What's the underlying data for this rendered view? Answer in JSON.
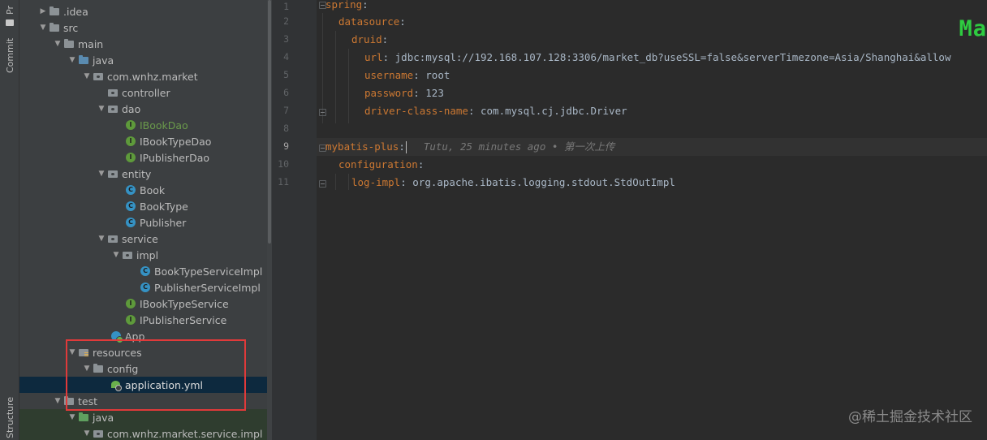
{
  "sidebar": {
    "project_tab": "Pr",
    "commit_tab": "Commit",
    "structure_tab": "Structure"
  },
  "tree": {
    "items": [
      {
        "label": ".idea"
      },
      {
        "label": "src"
      },
      {
        "label": "main"
      },
      {
        "label": "java"
      },
      {
        "label": "com.wnhz.market"
      },
      {
        "label": "controller"
      },
      {
        "label": "dao"
      },
      {
        "label": "IBookDao"
      },
      {
        "label": "IBookTypeDao"
      },
      {
        "label": "IPublisherDao"
      },
      {
        "label": "entity"
      },
      {
        "label": "Book"
      },
      {
        "label": "BookType"
      },
      {
        "label": "Publisher"
      },
      {
        "label": "service"
      },
      {
        "label": "impl"
      },
      {
        "label": "BookTypeServiceImpl"
      },
      {
        "label": "PublisherServiceImpl"
      },
      {
        "label": "IBookTypeService"
      },
      {
        "label": "IPublisherService"
      },
      {
        "label": "App"
      },
      {
        "label": "resources"
      },
      {
        "label": "config"
      },
      {
        "label": "application.yml"
      },
      {
        "label": "test"
      },
      {
        "label": "java"
      },
      {
        "label": "com.wnhz.market.service.impl"
      }
    ]
  },
  "editor": {
    "lines": [
      {
        "num": "1",
        "key": "spring",
        "sep": ":",
        "value": ""
      },
      {
        "num": "2",
        "key": "datasource",
        "sep": ":",
        "value": ""
      },
      {
        "num": "3",
        "key": "druid",
        "sep": ":",
        "value": ""
      },
      {
        "num": "4",
        "key": "url",
        "sep": ": ",
        "value": "jdbc:mysql://192.168.107.128:3306/market_db?useSSL=false&serverTimezone=Asia/Shanghai&allow"
      },
      {
        "num": "5",
        "key": "username",
        "sep": ": ",
        "value": "root"
      },
      {
        "num": "6",
        "key": "password",
        "sep": ": ",
        "value": "123"
      },
      {
        "num": "7",
        "key": "driver-class-name",
        "sep": ": ",
        "value": "com.mysql.cj.jdbc.Driver"
      },
      {
        "num": "8",
        "key": "",
        "sep": "",
        "value": ""
      },
      {
        "num": "9",
        "key": "mybatis-plus",
        "sep": ":",
        "value": ""
      },
      {
        "num": "10",
        "key": "configuration",
        "sep": ":",
        "value": ""
      },
      {
        "num": "11",
        "key": "log-impl",
        "sep": ": ",
        "value": "org.apache.ibatis.logging.stdout.StdOutImpl"
      }
    ],
    "blame": "Tutu, 25 minutes ago • 第一次上传",
    "corner_text": "Ma"
  },
  "watermark": "@稀土掘金技术社区"
}
